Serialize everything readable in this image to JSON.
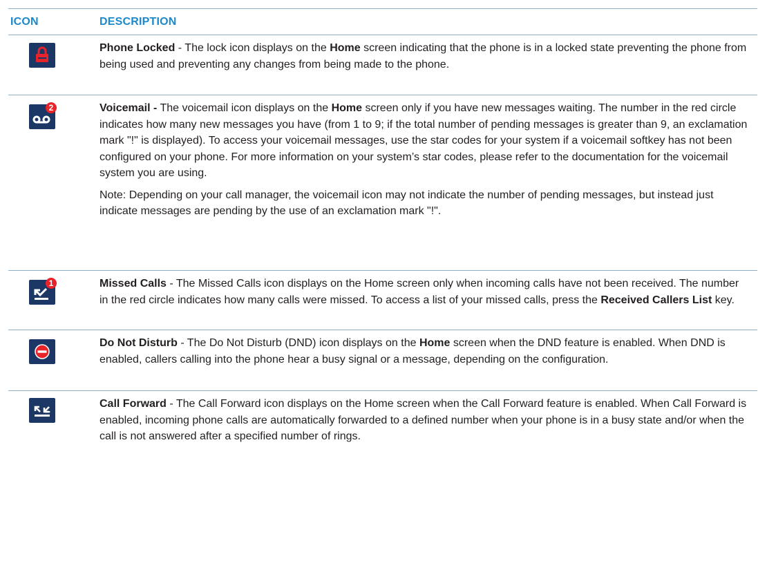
{
  "header": {
    "icon_col": "ICON",
    "desc_col": "DESCRIPTION"
  },
  "colors": {
    "header_text": "#1e88c8",
    "rule": "#8fb0c8",
    "icon_tile": "#1c3766",
    "badge": "#e8232a",
    "lock_red": "#e8232a"
  },
  "rows": [
    {
      "icon": "lock-icon",
      "title": "Phone Locked",
      "sep": " - The lock icon displays on the ",
      "b1": "Home",
      "t1": " screen indicating that the phone is in a locked state preventing the phone from being used and preventing any changes from being made to the phone."
    },
    {
      "icon": "voicemail-icon",
      "badge": "2",
      "title": "Voicemail -",
      "sep": " The voicemail icon displays on the ",
      "b1": "Home",
      "t1": " screen only if you have new messages waiting. The number in the red circle indicates how many new messages you have (from 1 to 9; if the total number of pending messages is greater than 9, an exclamation mark \"!\" is displayed). To access your voicemail messages, use the star codes for your system if a voicemail softkey has not been configured on your phone. For more information on your system’s star codes, please refer to the documentation for the voicemail system you are using.",
      "note": "Note: Depending on your call manager, the voicemail icon may not indicate the number of pending messages, but instead just indicate messages are pending by the use of an exclamation mark \"!\"."
    },
    {
      "icon": "missed-calls-icon",
      "badge": "1",
      "title": "Missed Calls",
      "sep": " - The Missed Calls icon displays on the Home screen only when incoming calls have not been received. The number in the red circle indicates how many calls were missed. To access a list of your missed calls, press the ",
      "b1": "Received Callers List",
      "t1": " key."
    },
    {
      "icon": "do-not-disturb-icon",
      "title": "Do Not Disturb",
      "sep": " - The Do Not Disturb (DND) icon displays on the ",
      "b1": "Home",
      "t1": " screen when the DND feature is enabled. When DND is enabled, callers calling into the phone hear a busy signal or a message, depending on the configuration."
    },
    {
      "icon": "call-forward-icon",
      "title": "Call Forward",
      "sep": " - The Call Forward icon displays on the Home screen when the Call Forward feature is enabled. When Call Forward is enabled, incoming phone calls are automatically forwarded to a defined number when your phone is in a busy state and/or when the call is not answered after a specified number of rings."
    }
  ]
}
